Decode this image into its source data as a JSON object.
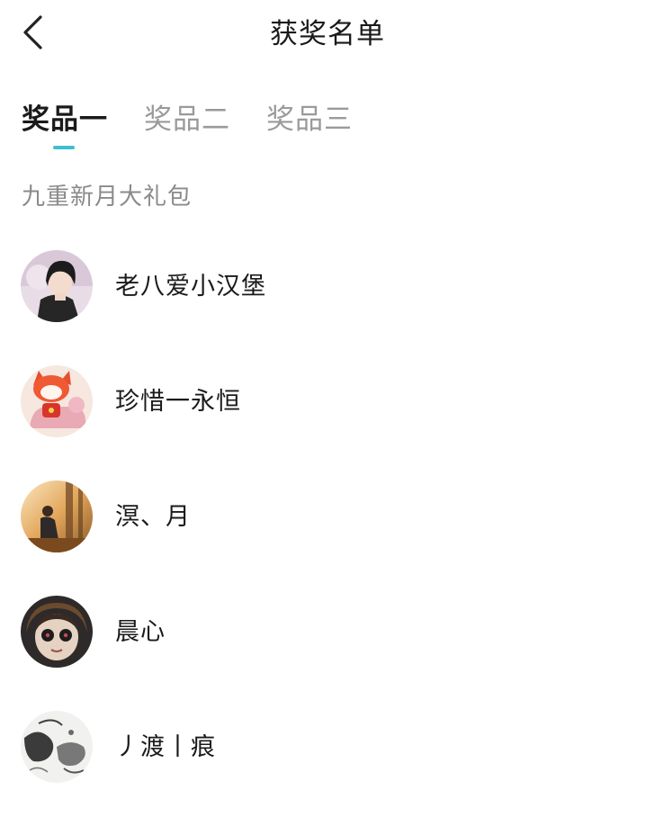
{
  "header": {
    "title": "获奖名单",
    "back_icon": "chevron-left-icon"
  },
  "tabs": [
    {
      "label": "奖品一",
      "active": true
    },
    {
      "label": "奖品二",
      "active": false
    },
    {
      "label": "奖品三",
      "active": false
    }
  ],
  "accent_color": "#3fbfcf",
  "prize": {
    "name": "九重新月大礼包"
  },
  "winners": [
    {
      "name": "老八爱小汉堡",
      "avatar": "anime-boy-avatar"
    },
    {
      "name": "珍惜一永恒",
      "avatar": "cartoon-fox-avatar"
    },
    {
      "name": "溟、月",
      "avatar": "autumn-photo-avatar"
    },
    {
      "name": "晨心",
      "avatar": "doll-face-avatar"
    },
    {
      "name": "丿渡丨痕",
      "avatar": "ink-painting-avatar"
    }
  ]
}
